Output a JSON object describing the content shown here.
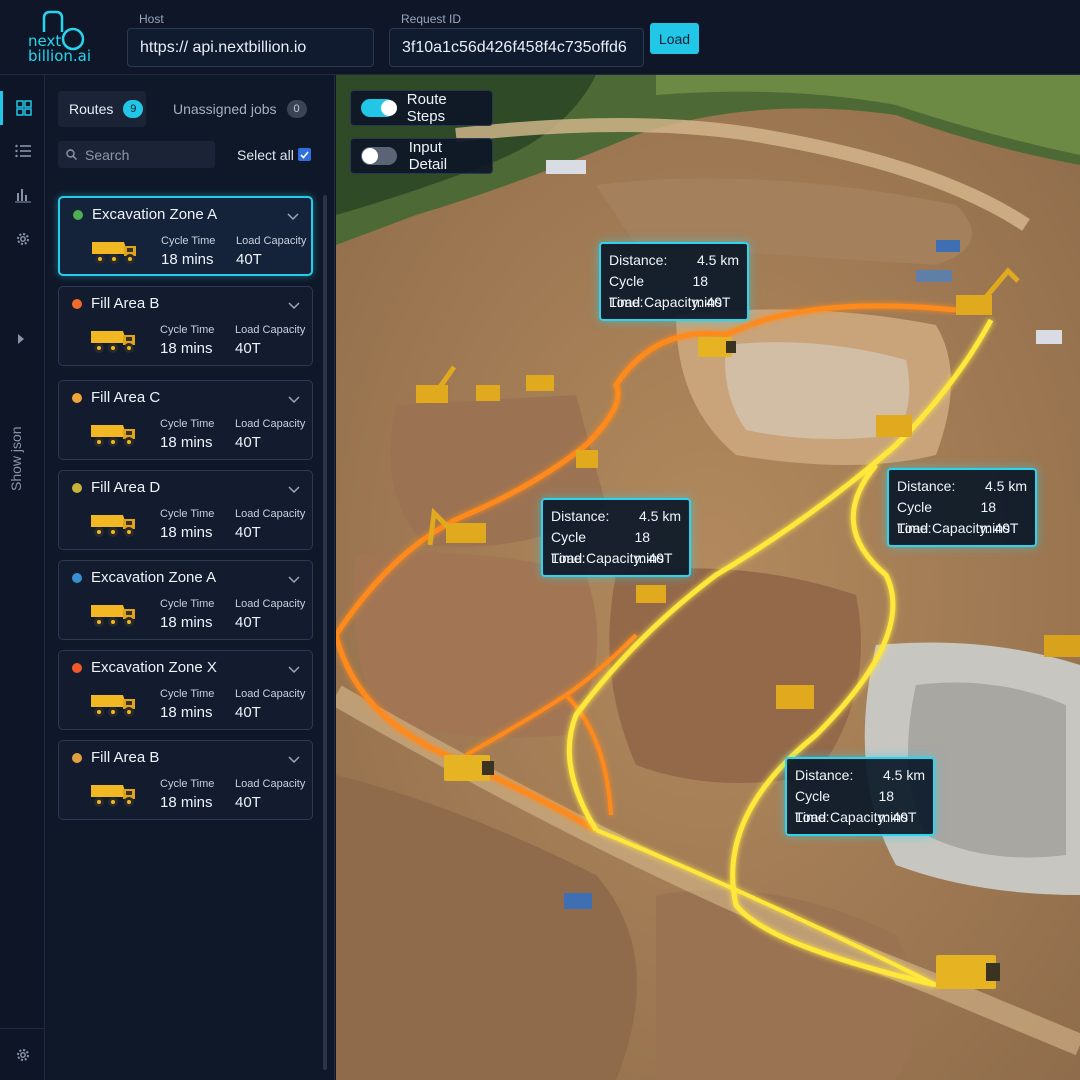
{
  "brand": {
    "line1": "next",
    "line2": "billion.ai"
  },
  "header": {
    "host_label": "Host",
    "host_value": "https:// api.nextbillion.io",
    "request_label": "Request ID",
    "request_value": "3f10a1c56d426f458f4c735offd6",
    "load_label": "Load"
  },
  "rail": {
    "items": [
      "grid-icon",
      "list-icon",
      "bar-chart-icon",
      "gear-icon"
    ],
    "show_json": "Show json"
  },
  "panel": {
    "tabs": [
      {
        "label": "Routes",
        "count": "9"
      },
      {
        "label": "Unassigned jobs",
        "count": "0"
      }
    ],
    "search_placeholder": "Search",
    "select_all": "Select all",
    "metric_labels": {
      "cycle": "Cycle Time",
      "load": "Load Capacity"
    },
    "routes": [
      {
        "name": "Excavation Zone A",
        "color": "#4caf50",
        "cycle": "18 mins",
        "load": "40T",
        "active": true
      },
      {
        "name": "Fill Area B",
        "color": "#f26a2e",
        "cycle": "18 mins",
        "load": "40T"
      },
      {
        "name": "Fill Area C",
        "color": "#f2a23a",
        "cycle": "18 mins",
        "load": "40T"
      },
      {
        "name": "Fill Area D",
        "color": "#c8b23a",
        "cycle": "18 mins",
        "load": "40T"
      },
      {
        "name": "Excavation Zone A",
        "color": "#3a8fd0",
        "cycle": "18 mins",
        "load": "40T"
      },
      {
        "name": "Excavation Zone X",
        "color": "#f05a2a",
        "cycle": "18 mins",
        "load": "40T"
      },
      {
        "name": "Fill Area B",
        "color": "#e0a040",
        "cycle": "18 mins",
        "load": "40T"
      }
    ]
  },
  "map": {
    "toggles": [
      {
        "label": "Route Steps",
        "on": true
      },
      {
        "label": "Input Detail",
        "on": false
      }
    ],
    "tooltip_labels": {
      "distance": "Distance:",
      "cycle": "Cycle Time:",
      "load": "Load Capacity: 40T"
    },
    "tooltips": [
      {
        "distance": "4.5 km",
        "cycle": "18 mins"
      },
      {
        "distance": "4.5 km",
        "cycle": "18 mins"
      },
      {
        "distance": "4.5 km",
        "cycle": "18 mins"
      },
      {
        "distance": "4.5 km",
        "cycle": "18 mins"
      }
    ],
    "route_colors": {
      "orange": "#ff8a1e",
      "yellow": "#ffe83a"
    }
  }
}
